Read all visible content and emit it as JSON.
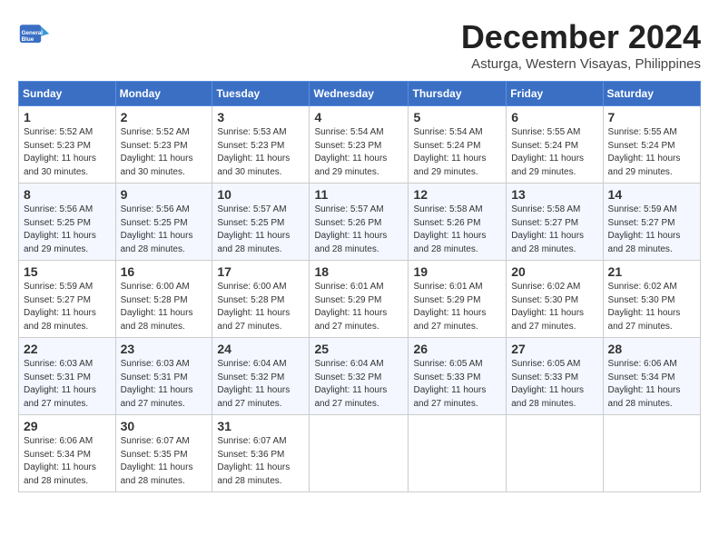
{
  "logo": {
    "line1": "General",
    "line2": "Blue"
  },
  "title": "December 2024",
  "location": "Asturga, Western Visayas, Philippines",
  "weekdays": [
    "Sunday",
    "Monday",
    "Tuesday",
    "Wednesday",
    "Thursday",
    "Friday",
    "Saturday"
  ],
  "weeks": [
    [
      {
        "day": "1",
        "sunrise": "Sunrise: 5:52 AM",
        "sunset": "Sunset: 5:23 PM",
        "daylight": "Daylight: 11 hours and 30 minutes."
      },
      {
        "day": "2",
        "sunrise": "Sunrise: 5:52 AM",
        "sunset": "Sunset: 5:23 PM",
        "daylight": "Daylight: 11 hours and 30 minutes."
      },
      {
        "day": "3",
        "sunrise": "Sunrise: 5:53 AM",
        "sunset": "Sunset: 5:23 PM",
        "daylight": "Daylight: 11 hours and 30 minutes."
      },
      {
        "day": "4",
        "sunrise": "Sunrise: 5:54 AM",
        "sunset": "Sunset: 5:23 PM",
        "daylight": "Daylight: 11 hours and 29 minutes."
      },
      {
        "day": "5",
        "sunrise": "Sunrise: 5:54 AM",
        "sunset": "Sunset: 5:24 PM",
        "daylight": "Daylight: 11 hours and 29 minutes."
      },
      {
        "day": "6",
        "sunrise": "Sunrise: 5:55 AM",
        "sunset": "Sunset: 5:24 PM",
        "daylight": "Daylight: 11 hours and 29 minutes."
      },
      {
        "day": "7",
        "sunrise": "Sunrise: 5:55 AM",
        "sunset": "Sunset: 5:24 PM",
        "daylight": "Daylight: 11 hours and 29 minutes."
      }
    ],
    [
      {
        "day": "8",
        "sunrise": "Sunrise: 5:56 AM",
        "sunset": "Sunset: 5:25 PM",
        "daylight": "Daylight: 11 hours and 29 minutes."
      },
      {
        "day": "9",
        "sunrise": "Sunrise: 5:56 AM",
        "sunset": "Sunset: 5:25 PM",
        "daylight": "Daylight: 11 hours and 28 minutes."
      },
      {
        "day": "10",
        "sunrise": "Sunrise: 5:57 AM",
        "sunset": "Sunset: 5:25 PM",
        "daylight": "Daylight: 11 hours and 28 minutes."
      },
      {
        "day": "11",
        "sunrise": "Sunrise: 5:57 AM",
        "sunset": "Sunset: 5:26 PM",
        "daylight": "Daylight: 11 hours and 28 minutes."
      },
      {
        "day": "12",
        "sunrise": "Sunrise: 5:58 AM",
        "sunset": "Sunset: 5:26 PM",
        "daylight": "Daylight: 11 hours and 28 minutes."
      },
      {
        "day": "13",
        "sunrise": "Sunrise: 5:58 AM",
        "sunset": "Sunset: 5:27 PM",
        "daylight": "Daylight: 11 hours and 28 minutes."
      },
      {
        "day": "14",
        "sunrise": "Sunrise: 5:59 AM",
        "sunset": "Sunset: 5:27 PM",
        "daylight": "Daylight: 11 hours and 28 minutes."
      }
    ],
    [
      {
        "day": "15",
        "sunrise": "Sunrise: 5:59 AM",
        "sunset": "Sunset: 5:27 PM",
        "daylight": "Daylight: 11 hours and 28 minutes."
      },
      {
        "day": "16",
        "sunrise": "Sunrise: 6:00 AM",
        "sunset": "Sunset: 5:28 PM",
        "daylight": "Daylight: 11 hours and 28 minutes."
      },
      {
        "day": "17",
        "sunrise": "Sunrise: 6:00 AM",
        "sunset": "Sunset: 5:28 PM",
        "daylight": "Daylight: 11 hours and 27 minutes."
      },
      {
        "day": "18",
        "sunrise": "Sunrise: 6:01 AM",
        "sunset": "Sunset: 5:29 PM",
        "daylight": "Daylight: 11 hours and 27 minutes."
      },
      {
        "day": "19",
        "sunrise": "Sunrise: 6:01 AM",
        "sunset": "Sunset: 5:29 PM",
        "daylight": "Daylight: 11 hours and 27 minutes."
      },
      {
        "day": "20",
        "sunrise": "Sunrise: 6:02 AM",
        "sunset": "Sunset: 5:30 PM",
        "daylight": "Daylight: 11 hours and 27 minutes."
      },
      {
        "day": "21",
        "sunrise": "Sunrise: 6:02 AM",
        "sunset": "Sunset: 5:30 PM",
        "daylight": "Daylight: 11 hours and 27 minutes."
      }
    ],
    [
      {
        "day": "22",
        "sunrise": "Sunrise: 6:03 AM",
        "sunset": "Sunset: 5:31 PM",
        "daylight": "Daylight: 11 hours and 27 minutes."
      },
      {
        "day": "23",
        "sunrise": "Sunrise: 6:03 AM",
        "sunset": "Sunset: 5:31 PM",
        "daylight": "Daylight: 11 hours and 27 minutes."
      },
      {
        "day": "24",
        "sunrise": "Sunrise: 6:04 AM",
        "sunset": "Sunset: 5:32 PM",
        "daylight": "Daylight: 11 hours and 27 minutes."
      },
      {
        "day": "25",
        "sunrise": "Sunrise: 6:04 AM",
        "sunset": "Sunset: 5:32 PM",
        "daylight": "Daylight: 11 hours and 27 minutes."
      },
      {
        "day": "26",
        "sunrise": "Sunrise: 6:05 AM",
        "sunset": "Sunset: 5:33 PM",
        "daylight": "Daylight: 11 hours and 27 minutes."
      },
      {
        "day": "27",
        "sunrise": "Sunrise: 6:05 AM",
        "sunset": "Sunset: 5:33 PM",
        "daylight": "Daylight: 11 hours and 28 minutes."
      },
      {
        "day": "28",
        "sunrise": "Sunrise: 6:06 AM",
        "sunset": "Sunset: 5:34 PM",
        "daylight": "Daylight: 11 hours and 28 minutes."
      }
    ],
    [
      {
        "day": "29",
        "sunrise": "Sunrise: 6:06 AM",
        "sunset": "Sunset: 5:34 PM",
        "daylight": "Daylight: 11 hours and 28 minutes."
      },
      {
        "day": "30",
        "sunrise": "Sunrise: 6:07 AM",
        "sunset": "Sunset: 5:35 PM",
        "daylight": "Daylight: 11 hours and 28 minutes."
      },
      {
        "day": "31",
        "sunrise": "Sunrise: 6:07 AM",
        "sunset": "Sunset: 5:36 PM",
        "daylight": "Daylight: 11 hours and 28 minutes."
      },
      null,
      null,
      null,
      null
    ]
  ]
}
